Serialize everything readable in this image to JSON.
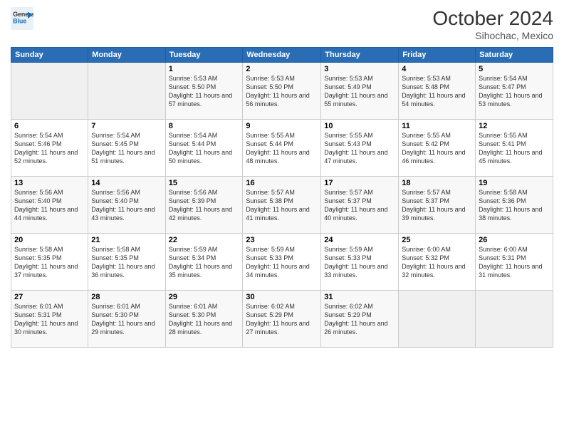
{
  "logo": {
    "line1": "General",
    "line2": "Blue"
  },
  "title": "October 2024",
  "subtitle": "Sihochac, Mexico",
  "days_of_week": [
    "Sunday",
    "Monday",
    "Tuesday",
    "Wednesday",
    "Thursday",
    "Friday",
    "Saturday"
  ],
  "weeks": [
    [
      {
        "day": "",
        "info": ""
      },
      {
        "day": "",
        "info": ""
      },
      {
        "day": "1",
        "info": "Sunrise: 5:53 AM\nSunset: 5:50 PM\nDaylight: 11 hours and 57 minutes."
      },
      {
        "day": "2",
        "info": "Sunrise: 5:53 AM\nSunset: 5:50 PM\nDaylight: 11 hours and 56 minutes."
      },
      {
        "day": "3",
        "info": "Sunrise: 5:53 AM\nSunset: 5:49 PM\nDaylight: 11 hours and 55 minutes."
      },
      {
        "day": "4",
        "info": "Sunrise: 5:53 AM\nSunset: 5:48 PM\nDaylight: 11 hours and 54 minutes."
      },
      {
        "day": "5",
        "info": "Sunrise: 5:54 AM\nSunset: 5:47 PM\nDaylight: 11 hours and 53 minutes."
      }
    ],
    [
      {
        "day": "6",
        "info": "Sunrise: 5:54 AM\nSunset: 5:46 PM\nDaylight: 11 hours and 52 minutes."
      },
      {
        "day": "7",
        "info": "Sunrise: 5:54 AM\nSunset: 5:45 PM\nDaylight: 11 hours and 51 minutes."
      },
      {
        "day": "8",
        "info": "Sunrise: 5:54 AM\nSunset: 5:44 PM\nDaylight: 11 hours and 50 minutes."
      },
      {
        "day": "9",
        "info": "Sunrise: 5:55 AM\nSunset: 5:44 PM\nDaylight: 11 hours and 48 minutes."
      },
      {
        "day": "10",
        "info": "Sunrise: 5:55 AM\nSunset: 5:43 PM\nDaylight: 11 hours and 47 minutes."
      },
      {
        "day": "11",
        "info": "Sunrise: 5:55 AM\nSunset: 5:42 PM\nDaylight: 11 hours and 46 minutes."
      },
      {
        "day": "12",
        "info": "Sunrise: 5:55 AM\nSunset: 5:41 PM\nDaylight: 11 hours and 45 minutes."
      }
    ],
    [
      {
        "day": "13",
        "info": "Sunrise: 5:56 AM\nSunset: 5:40 PM\nDaylight: 11 hours and 44 minutes."
      },
      {
        "day": "14",
        "info": "Sunrise: 5:56 AM\nSunset: 5:40 PM\nDaylight: 11 hours and 43 minutes."
      },
      {
        "day": "15",
        "info": "Sunrise: 5:56 AM\nSunset: 5:39 PM\nDaylight: 11 hours and 42 minutes."
      },
      {
        "day": "16",
        "info": "Sunrise: 5:57 AM\nSunset: 5:38 PM\nDaylight: 11 hours and 41 minutes."
      },
      {
        "day": "17",
        "info": "Sunrise: 5:57 AM\nSunset: 5:37 PM\nDaylight: 11 hours and 40 minutes."
      },
      {
        "day": "18",
        "info": "Sunrise: 5:57 AM\nSunset: 5:37 PM\nDaylight: 11 hours and 39 minutes."
      },
      {
        "day": "19",
        "info": "Sunrise: 5:58 AM\nSunset: 5:36 PM\nDaylight: 11 hours and 38 minutes."
      }
    ],
    [
      {
        "day": "20",
        "info": "Sunrise: 5:58 AM\nSunset: 5:35 PM\nDaylight: 11 hours and 37 minutes."
      },
      {
        "day": "21",
        "info": "Sunrise: 5:58 AM\nSunset: 5:35 PM\nDaylight: 11 hours and 36 minutes."
      },
      {
        "day": "22",
        "info": "Sunrise: 5:59 AM\nSunset: 5:34 PM\nDaylight: 11 hours and 35 minutes."
      },
      {
        "day": "23",
        "info": "Sunrise: 5:59 AM\nSunset: 5:33 PM\nDaylight: 11 hours and 34 minutes."
      },
      {
        "day": "24",
        "info": "Sunrise: 5:59 AM\nSunset: 5:33 PM\nDaylight: 11 hours and 33 minutes."
      },
      {
        "day": "25",
        "info": "Sunrise: 6:00 AM\nSunset: 5:32 PM\nDaylight: 11 hours and 32 minutes."
      },
      {
        "day": "26",
        "info": "Sunrise: 6:00 AM\nSunset: 5:31 PM\nDaylight: 11 hours and 31 minutes."
      }
    ],
    [
      {
        "day": "27",
        "info": "Sunrise: 6:01 AM\nSunset: 5:31 PM\nDaylight: 11 hours and 30 minutes."
      },
      {
        "day": "28",
        "info": "Sunrise: 6:01 AM\nSunset: 5:30 PM\nDaylight: 11 hours and 29 minutes."
      },
      {
        "day": "29",
        "info": "Sunrise: 6:01 AM\nSunset: 5:30 PM\nDaylight: 11 hours and 28 minutes."
      },
      {
        "day": "30",
        "info": "Sunrise: 6:02 AM\nSunset: 5:29 PM\nDaylight: 11 hours and 27 minutes."
      },
      {
        "day": "31",
        "info": "Sunrise: 6:02 AM\nSunset: 5:29 PM\nDaylight: 11 hours and 26 minutes."
      },
      {
        "day": "",
        "info": ""
      },
      {
        "day": "",
        "info": ""
      }
    ]
  ]
}
